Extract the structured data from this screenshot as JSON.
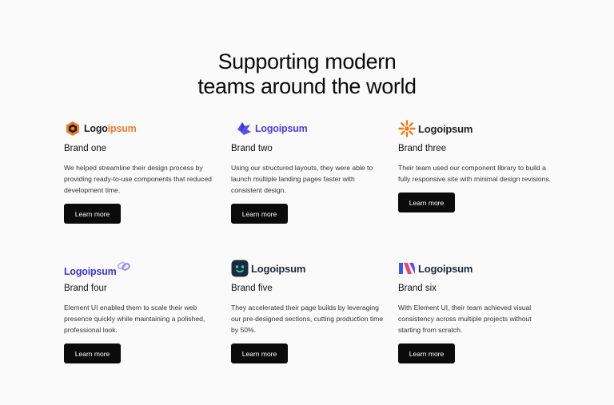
{
  "headline": {
    "line1": "Supporting modern",
    "line2": "teams around the world"
  },
  "colors": {
    "button_bg": "#0b0b0b",
    "button_text": "#ffffff",
    "page_bg": "#fafafa"
  },
  "brands": [
    {
      "logo_icon": "hexagon-logo-icon",
      "logo_text_dark": "Logo",
      "logo_text_accent": "ipsum",
      "logo_color_dark": "#222222",
      "logo_color_accent": "#f07a2e",
      "name": "Brand one",
      "description": "We helped streamline their design process by providing ready-to-use components that reduced development time.",
      "button": "Learn more"
    },
    {
      "logo_icon": "bird-logo-icon",
      "logo_text": "Logoipsum",
      "logo_color": "#4b3fd6",
      "name": "Brand two",
      "description": "Using our structured layouts, they were able to launch multiple landing pages faster with consistent design.",
      "button": "Learn more"
    },
    {
      "logo_icon": "sunburst-logo-icon",
      "logo_text": "Logoipsum",
      "logo_color": "#222222",
      "logo_icon_color": "#f07a1a",
      "name": "Brand three",
      "description": "Their team used our component library to build a fully responsive site with minimal design revisions.",
      "button": "Learn more"
    },
    {
      "logo_icon": "chain-logo-icon",
      "logo_text": "Logoipsum",
      "logo_color": "#3d35c7",
      "name": "Brand four",
      "description": "Element UI enabled them to scale their web presence quickly while maintaining a polished, professional look.",
      "button": "Learn more"
    },
    {
      "logo_icon": "robot-face-logo-icon",
      "logo_text": "Logoipsum",
      "logo_color": "#1e2a3a",
      "logo_icon_color": "#2fd3c8",
      "name": "Brand five",
      "description": "They accelerated their page builds by leveraging our pre-designed sections, cutting production time by 50%.",
      "button": "Learn more"
    },
    {
      "logo_icon": "stripes-logo-icon",
      "logo_text": "Logoipsum",
      "logo_color": "#1e2a3a",
      "name": "Brand six",
      "description": "With Element UI, their team achieved visual consistency across multiple projects without starting from scratch.",
      "button": "Learn more"
    }
  ]
}
